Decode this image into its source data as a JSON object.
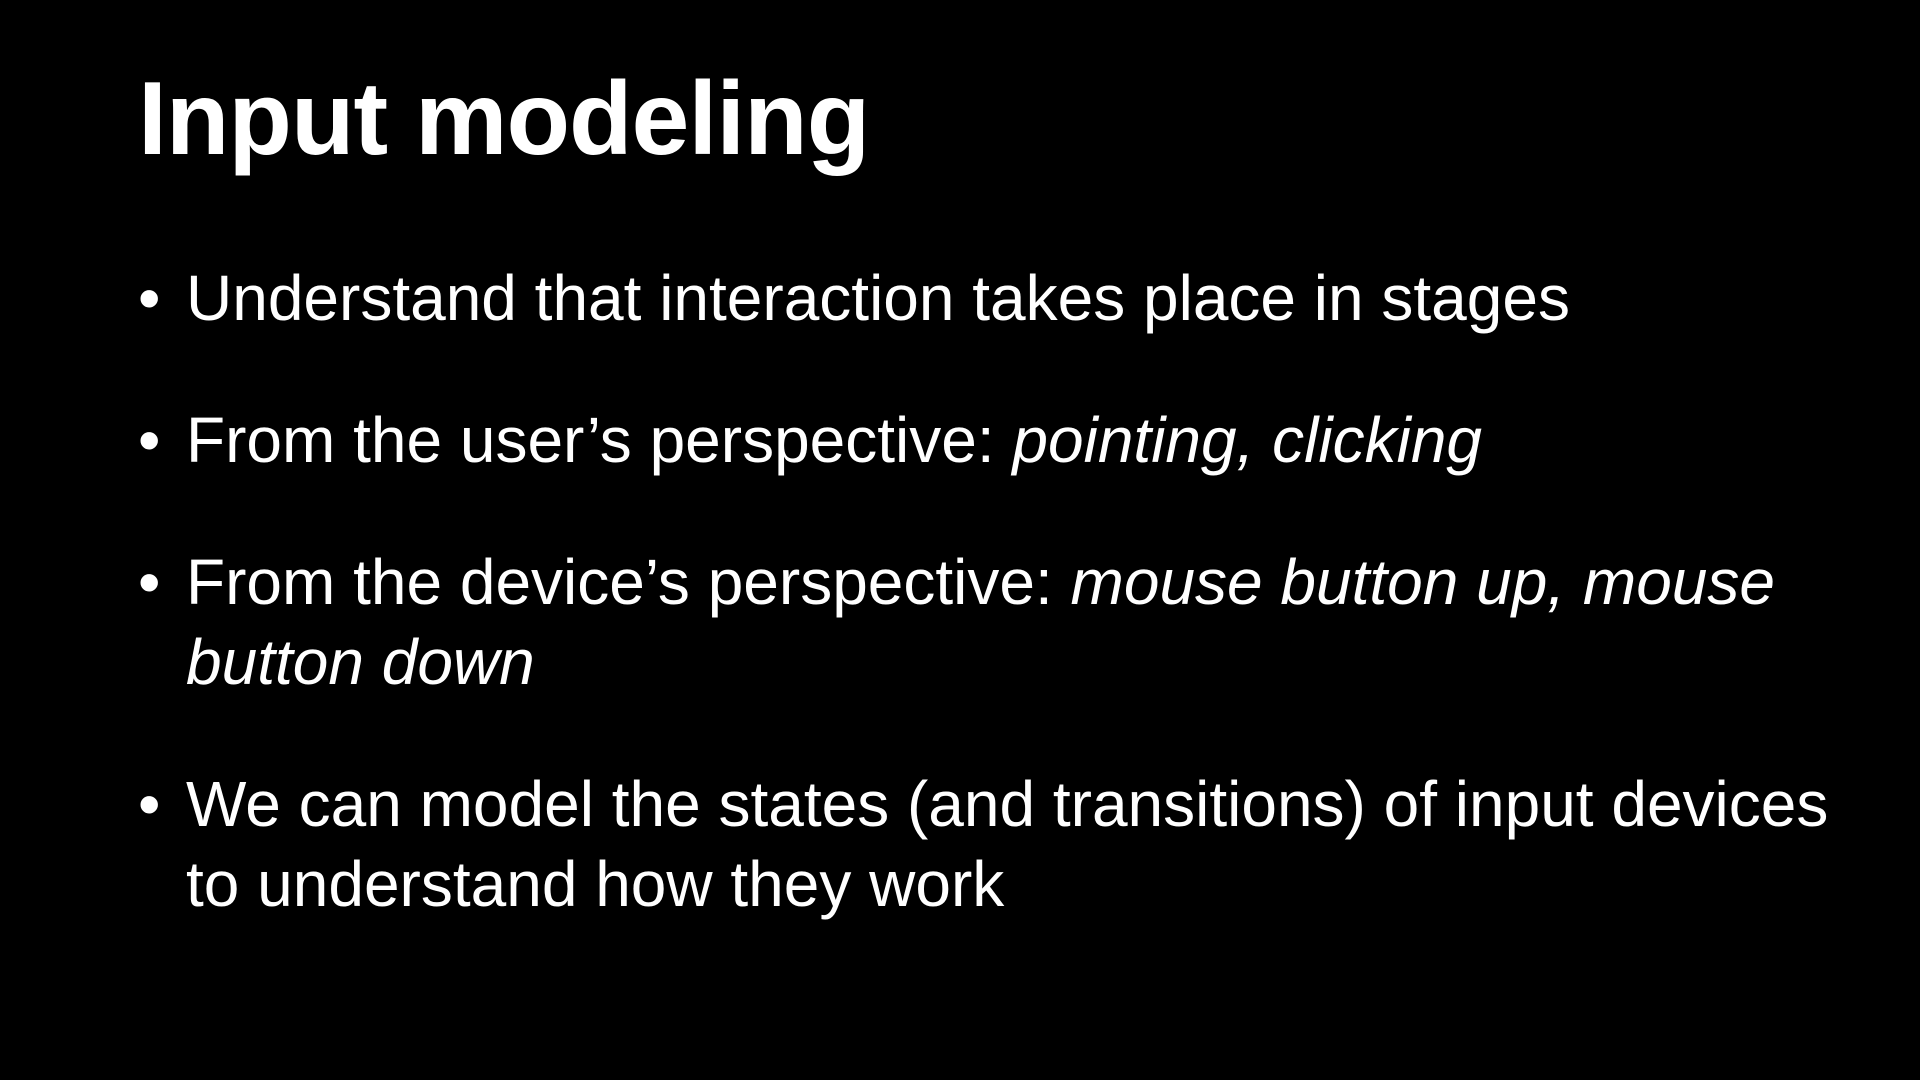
{
  "slide": {
    "title": "Input modeling",
    "bullet_marker": "•",
    "bullets": [
      {
        "text": "Understand that interaction takes place in stages",
        "emphasis": ""
      },
      {
        "text": "From the user’s perspective: ",
        "emphasis": "pointing, clicking"
      },
      {
        "text": "From the device’s perspective: ",
        "emphasis": "mouse button up, mouse button down"
      },
      {
        "text": "We can model the states (and transitions) of input devices to understand how they work",
        "emphasis": ""
      }
    ]
  },
  "colors": {
    "background": "#000000",
    "text": "#ffffff"
  }
}
